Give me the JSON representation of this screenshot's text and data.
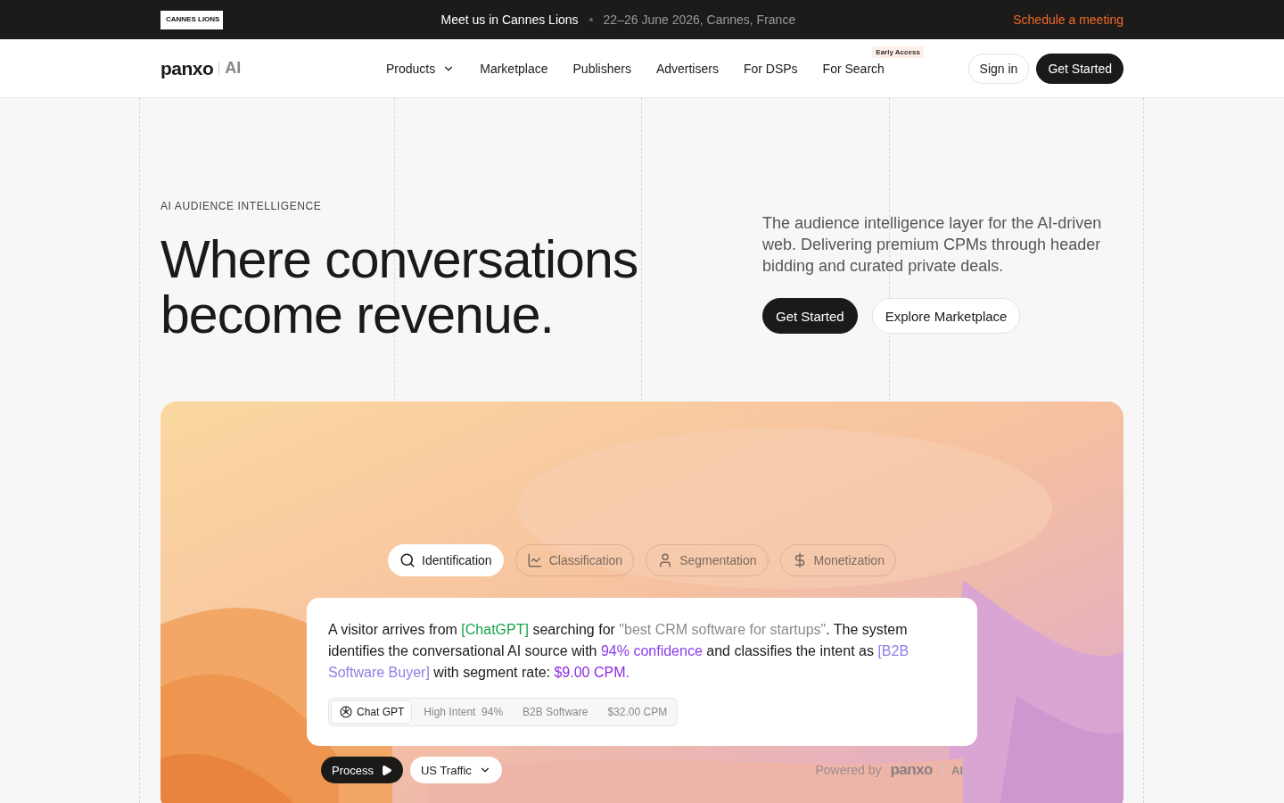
{
  "announcement": {
    "badge": "CANNES LIONS",
    "title": "Meet us in Cannes Lions",
    "details": "22–26 June 2026, Cannes, France",
    "link": "Schedule a meeting"
  },
  "nav": {
    "logo": "panxo",
    "logo_suffix": "AI",
    "items": [
      {
        "label": "Products",
        "kind": "dropdown"
      },
      {
        "label": "Marketplace",
        "kind": "link"
      },
      {
        "label": "Publishers",
        "kind": "link"
      },
      {
        "label": "Advertisers",
        "kind": "link"
      },
      {
        "label": "For DSPs",
        "kind": "link"
      },
      {
        "label": "For Search",
        "kind": "link",
        "badge": "Early Access"
      }
    ],
    "sign_in": "Sign in",
    "cta": "Get Started"
  },
  "hero": {
    "eyebrow": "AI AUDIENCE INTELLIGENCE",
    "headline": "Where conversations become revenue.",
    "description": "The audience intelligence layer for the AI-driven web. Delivering premium CPMs through header bidding and curated private deals.",
    "primary": "Get Started",
    "secondary": "Explore Marketplace"
  },
  "demo": {
    "tabs": [
      {
        "label": "Identification",
        "kind": "search",
        "selected": true
      },
      {
        "label": "Classification",
        "kind": "chart",
        "selected": false
      },
      {
        "label": "Segmentation",
        "kind": "user",
        "selected": false
      },
      {
        "label": "Monetization",
        "kind": "dollar",
        "selected": false
      }
    ],
    "message": [
      {
        "kind": "plain",
        "text": "A visitor arrives from "
      },
      {
        "kind": "source",
        "text": "[ChatGPT]"
      },
      {
        "kind": "plain",
        "text": " searching for "
      },
      {
        "kind": "query",
        "text": "\"best CRM software for startups\""
      },
      {
        "kind": "plain",
        "text": ". The system identifies the conversational AI source with "
      },
      {
        "kind": "confidence",
        "text": "94% confidence"
      },
      {
        "kind": "plain",
        "text": " and classifies the intent as "
      },
      {
        "kind": "segment",
        "text": "[B2B Software Buyer]"
      },
      {
        "kind": "plain",
        "text": " with segment rate: "
      },
      {
        "kind": "rate",
        "text": "$9.00 CPM."
      }
    ],
    "chips": [
      {
        "kind": "source",
        "text": "Chat GPT"
      },
      {
        "kind": "plain",
        "text": "High Intent  94%"
      },
      {
        "kind": "plain",
        "text": "B2B Software"
      },
      {
        "kind": "plain",
        "text": "$32.00 CPM"
      }
    ],
    "process": "Process",
    "traffic": "US Traffic",
    "powered_by": "Powered by",
    "powered_logo": "panxo",
    "powered_suffix": "AI"
  }
}
